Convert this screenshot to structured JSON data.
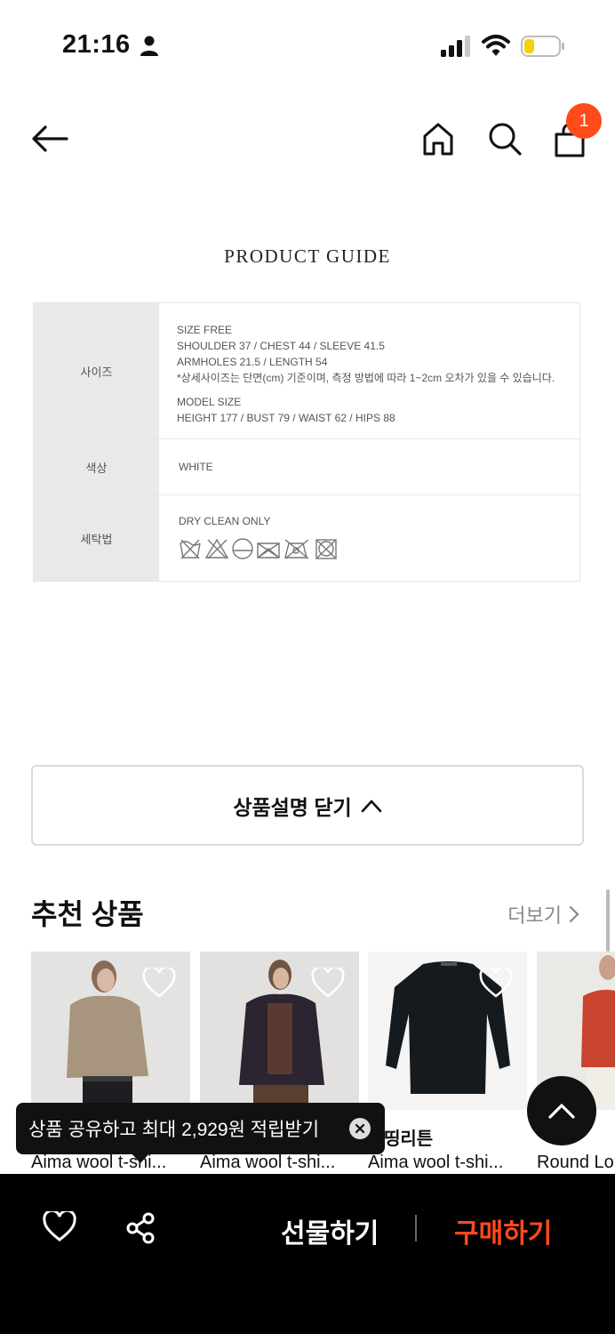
{
  "status_bar": {
    "time": "21:16"
  },
  "header": {
    "cart_count": "1"
  },
  "product_guide": {
    "title": "PRODUCT GUIDE",
    "size_label": "사이즈",
    "size_line1": "SIZE  FREE",
    "size_line2": "SHOULDER  37  /   CHEST  44  /   SLEEVE  41.5",
    "size_line3": "ARMHOLES  21.5  /  LENGTH 54",
    "size_note": "*상세사이즈는 단면(cm) 기준이며, 측정 방법에 따라 1~2cm 오차가 있을 수 있습니다.",
    "model_line1": "MODEL SIZE",
    "model_line2": "HEIGHT 177 / BUST 79 / WAIST 62 / HIPS 88",
    "color_label": "색상",
    "color_value": "WHITE",
    "wash_label": "세탁법",
    "wash_value": "DRY CLEAN ONLY"
  },
  "close_description_label": "상품설명 닫기",
  "recommended": {
    "title": "추천 상품",
    "more_label": "더보기",
    "items": [
      {
        "name": "Aima wool t-shi...",
        "sub": ""
      },
      {
        "name": "Aima wool t-shi...",
        "sub": ""
      },
      {
        "name": "Aima wool t-shi...",
        "sub": "띵리튼"
      },
      {
        "name": "Round Lo",
        "sub": ""
      }
    ]
  },
  "toast": {
    "text": "상품 공유하고 최대 2,929원 적립받기"
  },
  "bottom_bar": {
    "gift_label": "선물하기",
    "buy_label": "구매하기"
  },
  "colors": {
    "accent": "#ff4a1a",
    "bar": "#000000"
  }
}
